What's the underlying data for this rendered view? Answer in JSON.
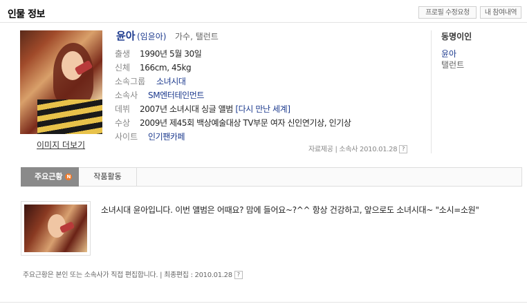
{
  "header": {
    "title": "인물 정보",
    "btn_request": "프로필 수정요청",
    "btn_history": "내 참여내역"
  },
  "photo": {
    "more_label": "이미지 더보기"
  },
  "profile": {
    "name": "윤아",
    "real_name": "(임윤아)",
    "job": "가수, 탤런트",
    "rows": [
      {
        "label": "출생",
        "value": "1990년 5월 30일"
      },
      {
        "label": "신체",
        "value": "166cm, 45kg"
      },
      {
        "label": "소속그룹",
        "value": "소녀시대"
      },
      {
        "label": "소속사",
        "value": "SM엔터테인먼트"
      },
      {
        "label": "데뷔",
        "value": "2007년 소녀시대 싱글 앨범",
        "value_link": "[다시 만난 세계]"
      },
      {
        "label": "수상",
        "value": "2009년 제45회 백상예술대상 TV부문 여자 신인연기상, 인기상"
      },
      {
        "label": "사이트",
        "value": "인기팬카페"
      }
    ]
  },
  "source": {
    "text": "자료제공 | 소속사 2010.01.28"
  },
  "same_name": {
    "title": "동명이인",
    "link": "윤아",
    "job": "탤런트"
  },
  "tabs": [
    {
      "label": "주요근황",
      "badge": "N"
    },
    {
      "label": "작품활동"
    }
  ],
  "status": {
    "message": "소녀시대 윤아입니다. 이번 앨범은 어때요? 맘에 들어요~?^^ 항상 건강하고, 앞으로도 소녀시대~ \"소시=소원\"",
    "footer": "주요근황은 본인 또는 소속사가 직접 편집합니다. | 최종편집 : 2010.01.28"
  },
  "colors": {
    "link": "#1c3a8e",
    "tab_active": "#8a8a8a",
    "badge": "#f07a2a"
  }
}
